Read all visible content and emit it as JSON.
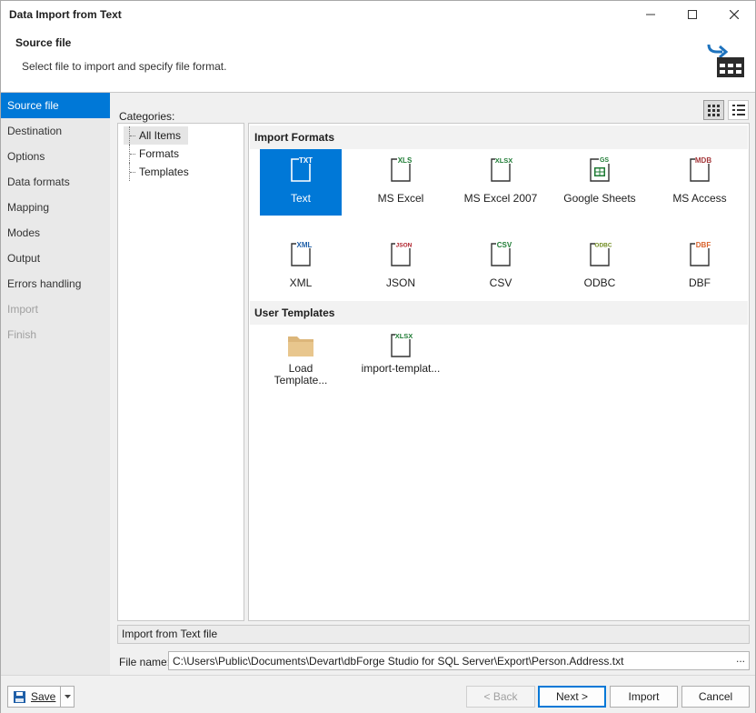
{
  "window": {
    "title": "Data Import from Text",
    "minimize_icon": "minimize-icon",
    "maximize_icon": "maximize-icon",
    "close_icon": "close-icon"
  },
  "header": {
    "title": "Source file",
    "subtitle": "Select file to import and specify file format.",
    "icon": "import-to-table-icon"
  },
  "sidebar": {
    "items": [
      {
        "label": "Source file",
        "state": "active"
      },
      {
        "label": "Destination",
        "state": "enabled"
      },
      {
        "label": "Options",
        "state": "enabled"
      },
      {
        "label": "Data formats",
        "state": "enabled"
      },
      {
        "label": "Mapping",
        "state": "enabled"
      },
      {
        "label": "Modes",
        "state": "enabled"
      },
      {
        "label": "Output",
        "state": "enabled"
      },
      {
        "label": "Errors handling",
        "state": "enabled"
      },
      {
        "label": "Import",
        "state": "disabled"
      },
      {
        "label": "Finish",
        "state": "disabled"
      }
    ]
  },
  "categories": {
    "label": "Categories:",
    "items": [
      "All Items",
      "Formats",
      "Templates"
    ],
    "selected": "All Items"
  },
  "view_toggle": {
    "large_icons": "large-icons-view-icon",
    "list": "list-view-icon"
  },
  "gallery": {
    "import_formats_header": "Import Formats",
    "formats": [
      {
        "label": "Text",
        "tag": "TXT",
        "color": "#ffffff",
        "selected": true
      },
      {
        "label": "MS Excel",
        "tag": "XLS",
        "color": "#1e7b34"
      },
      {
        "label": "MS Excel 2007",
        "tag": "XLSX",
        "color": "#1e7b34"
      },
      {
        "label": "Google Sheets",
        "tag": "GS",
        "color": "#1e7b34"
      },
      {
        "label": "MS Access",
        "tag": "MDB",
        "color": "#a4373a"
      },
      {
        "label": "XML",
        "tag": "XML",
        "color": "#1f5fa8"
      },
      {
        "label": "JSON",
        "tag": "JSON",
        "color": "#b0202a"
      },
      {
        "label": "CSV",
        "tag": "CSV",
        "color": "#1e7b34"
      },
      {
        "label": "ODBC",
        "tag": "ODBC",
        "color": "#6f8b1e"
      },
      {
        "label": "DBF",
        "tag": "DBF",
        "color": "#d9622b"
      }
    ],
    "user_templates_header": "User Templates",
    "templates": [
      {
        "label": "Load Template...",
        "icon": "folder-icon"
      },
      {
        "label": "import-templat...",
        "tag": "XLSX",
        "color": "#1e7b34"
      }
    ]
  },
  "status": {
    "text": "Import from Text file"
  },
  "file": {
    "label": "File name:",
    "value": "C:\\Users\\Public\\Documents\\Devart\\dbForge Studio for SQL Server\\Export\\Person.Address.txt",
    "browse_label": "..."
  },
  "footer": {
    "save_label": "Save",
    "back_label": "< Back",
    "next_label": "Next >",
    "import_label": "Import",
    "cancel_label": "Cancel"
  },
  "colors": {
    "accent": "#0078d7",
    "sidebar_bg": "#e9e9e9",
    "disabled_text": "#a0a0a0"
  }
}
